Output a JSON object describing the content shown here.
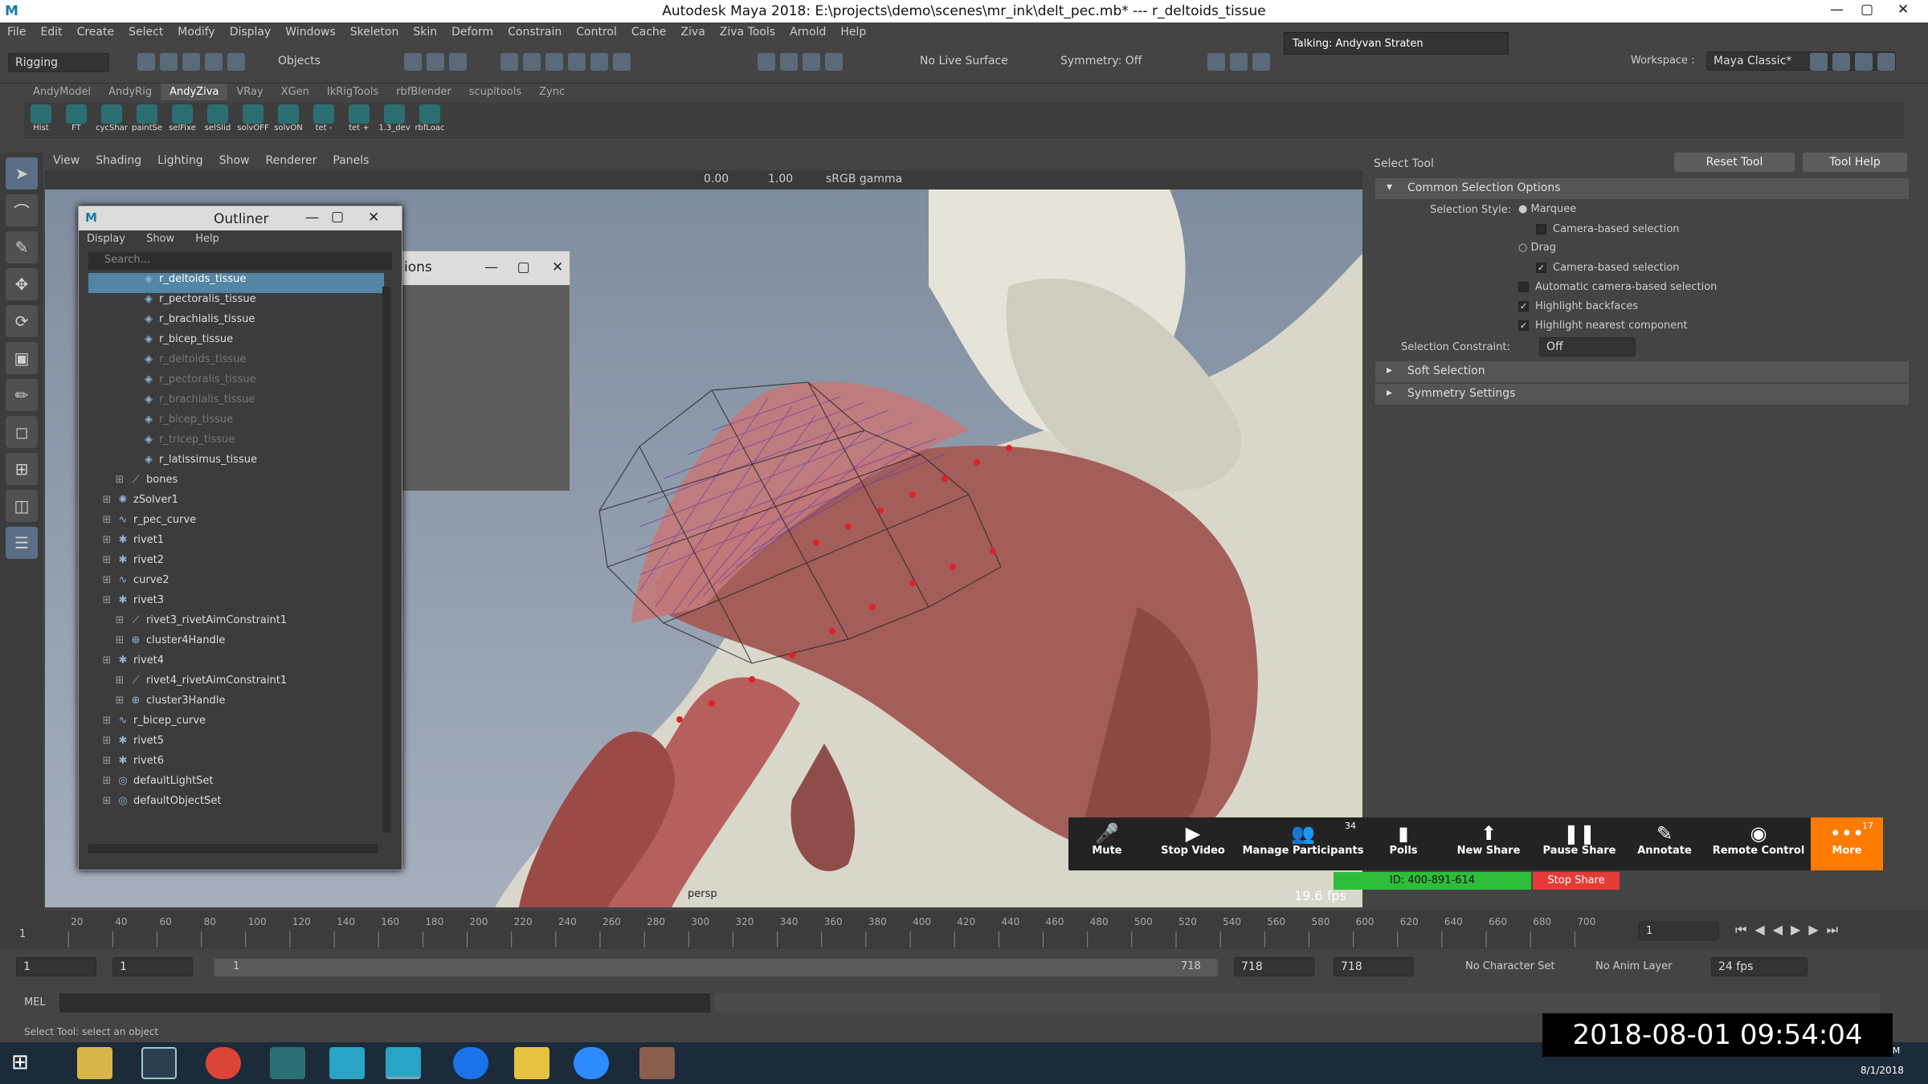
{
  "window": {
    "title": "Autodesk Maya 2018: E:\\projects\\demo\\scenes\\mr_ink\\delt_pec.mb*   ---   r_deltoids_tissue"
  },
  "menu": [
    "File",
    "Edit",
    "Create",
    "Select",
    "Modify",
    "Display",
    "Windows",
    "Skeleton",
    "Skin",
    "Deform",
    "Constrain",
    "Control",
    "Cache",
    "Ziva",
    "Ziva Tools",
    "Arnold",
    "Help"
  ],
  "status": {
    "menuset": "Rigging",
    "objects": "Objects",
    "live_surface": "No Live Surface",
    "symmetry": "Symmetry: Off",
    "workspace_label": "Workspace :",
    "workspace": "Maya Classic*",
    "talking": "Talking: Andyvan Straten"
  },
  "shelf_tabs": [
    "AndyModel",
    "AndyRig",
    "AndyZiva",
    "VRay",
    "XGen",
    "IkRigTools",
    "rbfBlender",
    "scupltools",
    "Zync"
  ],
  "shelf_buttons": [
    "Hist",
    "FT",
    "cycShar",
    "paintSe",
    "selFixe",
    "selSlid",
    "solvOFF",
    "solvON",
    "tet -",
    "tet +",
    "1.3_dev",
    "rbfLoac"
  ],
  "panel_menu": [
    "View",
    "Shading",
    "Lighting",
    "Show",
    "Renderer",
    "Panels"
  ],
  "panel_toolbar": {
    "v1": "0.00",
    "v2": "1.00",
    "colorspace": "sRGB gamma"
  },
  "viewport": {
    "camera": "persp",
    "fps": "19.6 fps"
  },
  "outliner": {
    "title": "Outliner",
    "menu": [
      "Display",
      "Show",
      "Help"
    ],
    "search": "Search...",
    "rows": [
      {
        "label": "r_deltoids_tissue",
        "indent": 3,
        "icon": "◈",
        "state": "sel"
      },
      {
        "label": "r_pectoralis_tissue",
        "indent": 3,
        "icon": "◈",
        "state": ""
      },
      {
        "label": "r_brachialis_tissue",
        "indent": 3,
        "icon": "◈",
        "state": ""
      },
      {
        "label": "r_bicep_tissue",
        "indent": 3,
        "icon": "◈",
        "state": ""
      },
      {
        "label": "r_deltoids_tissue",
        "indent": 3,
        "icon": "◈",
        "state": "dim"
      },
      {
        "label": "r_pectoralis_tissue",
        "indent": 3,
        "icon": "◈",
        "state": "dim"
      },
      {
        "label": "r_brachialis_tissue",
        "indent": 3,
        "icon": "◈",
        "state": "dim"
      },
      {
        "label": "r_bicep_tissue",
        "indent": 3,
        "icon": "◈",
        "state": "dim"
      },
      {
        "label": "r_tricep_tissue",
        "indent": 3,
        "icon": "◈",
        "state": "dim"
      },
      {
        "label": "r_latissimus_tissue",
        "indent": 3,
        "icon": "◈",
        "state": ""
      },
      {
        "label": "bones",
        "indent": 2,
        "icon": "⟋",
        "state": ""
      },
      {
        "label": "zSolver1",
        "indent": 1,
        "icon": "✺",
        "state": ""
      },
      {
        "label": "r_pec_curve",
        "indent": 1,
        "icon": "∿",
        "state": ""
      },
      {
        "label": "rivet1",
        "indent": 1,
        "icon": "✱",
        "state": ""
      },
      {
        "label": "rivet2",
        "indent": 1,
        "icon": "✱",
        "state": ""
      },
      {
        "label": "curve2",
        "indent": 1,
        "icon": "∿",
        "state": ""
      },
      {
        "label": "rivet3",
        "indent": 1,
        "icon": "✱",
        "state": ""
      },
      {
        "label": "rivet3_rivetAimConstraint1",
        "indent": 2,
        "icon": "⟋",
        "state": ""
      },
      {
        "label": "cluster4Handle",
        "indent": 2,
        "icon": "⊕",
        "state": ""
      },
      {
        "label": "rivet4",
        "indent": 1,
        "icon": "✱",
        "state": ""
      },
      {
        "label": "rivet4_rivetAimConstraint1",
        "indent": 2,
        "icon": "⟋",
        "state": ""
      },
      {
        "label": "cluster3Handle",
        "indent": 2,
        "icon": "⊕",
        "state": ""
      },
      {
        "label": "r_bicep_curve",
        "indent": 1,
        "icon": "∿",
        "state": ""
      },
      {
        "label": "rivet5",
        "indent": 1,
        "icon": "✱",
        "state": ""
      },
      {
        "label": "rivet6",
        "indent": 1,
        "icon": "✱",
        "state": ""
      },
      {
        "label": "defaultLightSet",
        "indent": 1,
        "icon": "◎",
        "state": ""
      },
      {
        "label": "defaultObjectSet",
        "indent": 1,
        "icon": "◎",
        "state": ""
      }
    ]
  },
  "ghost": {
    "title": "ions"
  },
  "tool_settings": {
    "title": "Select Tool",
    "reset": "Reset Tool",
    "help": "Tool Help",
    "common": "Common Selection Options",
    "style_label": "Selection Style:",
    "marquee": "Marquee",
    "camera_based1": "Camera-based selection",
    "drag": "Drag",
    "camera_based2": "Camera-based selection",
    "auto_camera": "Automatic camera-based selection",
    "backfaces": "Highlight backfaces",
    "nearest": "Highlight nearest component",
    "constraint_label": "Selection Constraint:",
    "constraint": "Off",
    "soft": "Soft Selection",
    "symmetry": "Symmetry Settings"
  },
  "zoom": {
    "buttons": [
      {
        "icon": "🎤",
        "label": "Mute"
      },
      {
        "icon": "▶",
        "label": "Stop Video"
      },
      {
        "icon": "👥",
        "label": "Manage Participants",
        "badge": "34"
      },
      {
        "icon": "▮",
        "label": "Polls"
      },
      {
        "icon": "⬆",
        "label": "New Share"
      },
      {
        "icon": "❚❚",
        "label": "Pause Share"
      },
      {
        "icon": "✎",
        "label": "Annotate"
      },
      {
        "icon": "◉",
        "label": "Remote Control"
      },
      {
        "icon": "•••",
        "label": "More",
        "badge": "17"
      }
    ],
    "id": "ID: 400-891-614",
    "stop": "Stop Share"
  },
  "timeline": {
    "ticks": [
      "20",
      "40",
      "60",
      "80",
      "100",
      "120",
      "140",
      "160",
      "180",
      "200",
      "220",
      "240",
      "260",
      "280",
      "300",
      "320",
      "340",
      "360",
      "380",
      "400",
      "420",
      "440",
      "460",
      "480",
      "500",
      "520",
      "540",
      "560",
      "580",
      "600",
      "620",
      "640",
      "660",
      "680",
      "700"
    ],
    "start_mark": "1",
    "current": "1"
  },
  "range": {
    "start": "1",
    "start2": "1",
    "inner": "1",
    "end_inner": "718",
    "end": "718",
    "end2": "718",
    "char_set": "No Character Set",
    "anim_layer": "No Anim Layer",
    "fps": "24 fps"
  },
  "cmd": {
    "label": "MEL"
  },
  "help_line": "Select Tool: select an object",
  "clock": "2018-08-01  09:54:04",
  "taskbar": {
    "time": "9:54 AM",
    "date": "8/1/2018"
  }
}
